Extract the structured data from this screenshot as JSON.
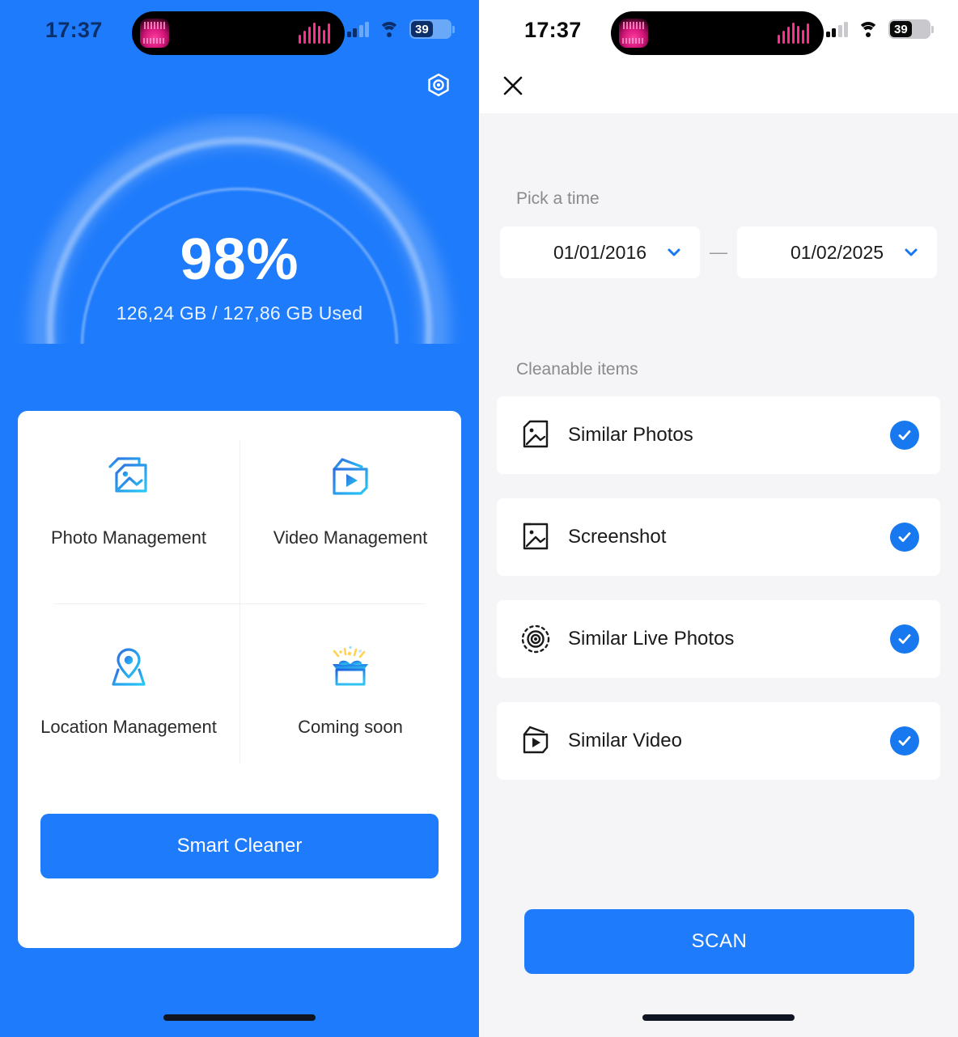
{
  "colors": {
    "brand_blue": "#1e7bfb",
    "check_blue": "#1878f0",
    "card_white": "#ffffff",
    "page_gray": "#f5f5f7",
    "label_gray": "#8a8a8e"
  },
  "left_screen": {
    "status_bar": {
      "time": "17:37",
      "battery_level": "39",
      "cellular_icon": "cellular-signal-icon",
      "wifi_icon": "wifi-icon",
      "battery_icon": "battery-icon",
      "dynamic_island_icon": "music-app-icon",
      "audio_visualizer_icon": "audio-bars-icon"
    },
    "settings_icon": "gear-icon",
    "gauge": {
      "percent": "98%",
      "percent_value": 98,
      "storage_text": "126,24 GB / 127,86 GB Used",
      "used_gb": "126,24",
      "total_gb": "127,86"
    },
    "features": [
      {
        "label": "Photo Management",
        "icon": "photo-stack-icon"
      },
      {
        "label": "Video Management",
        "icon": "video-frame-icon"
      },
      {
        "label": "Location Management",
        "icon": "map-pin-icon"
      },
      {
        "label": "Coming soon",
        "icon": "gift-box-icon"
      }
    ],
    "smart_cleaner_button": "Smart Cleaner"
  },
  "right_screen": {
    "status_bar": {
      "time": "17:37",
      "battery_level": "39",
      "cellular_icon": "cellular-signal-icon",
      "wifi_icon": "wifi-icon",
      "battery_icon": "battery-icon",
      "dynamic_island_icon": "music-app-icon",
      "audio_visualizer_icon": "audio-bars-icon"
    },
    "close_icon": "close-icon",
    "pick_time_label": "Pick a time",
    "date_from": "01/01/2016",
    "date_to": "01/02/2025",
    "date_separator": "—",
    "chevron_icon": "chevron-down-icon",
    "cleanable_label": "Cleanable items",
    "cleanable_items": [
      {
        "label": "Similar Photos",
        "icon": "photo-corner-fold-icon",
        "checked": true
      },
      {
        "label": "Screenshot",
        "icon": "screenshot-photo-icon",
        "checked": true
      },
      {
        "label": "Similar Live Photos",
        "icon": "live-photo-icon",
        "checked": true
      },
      {
        "label": "Similar Video",
        "icon": "video-play-frame-icon",
        "checked": true
      }
    ],
    "scan_button": "SCAN"
  }
}
